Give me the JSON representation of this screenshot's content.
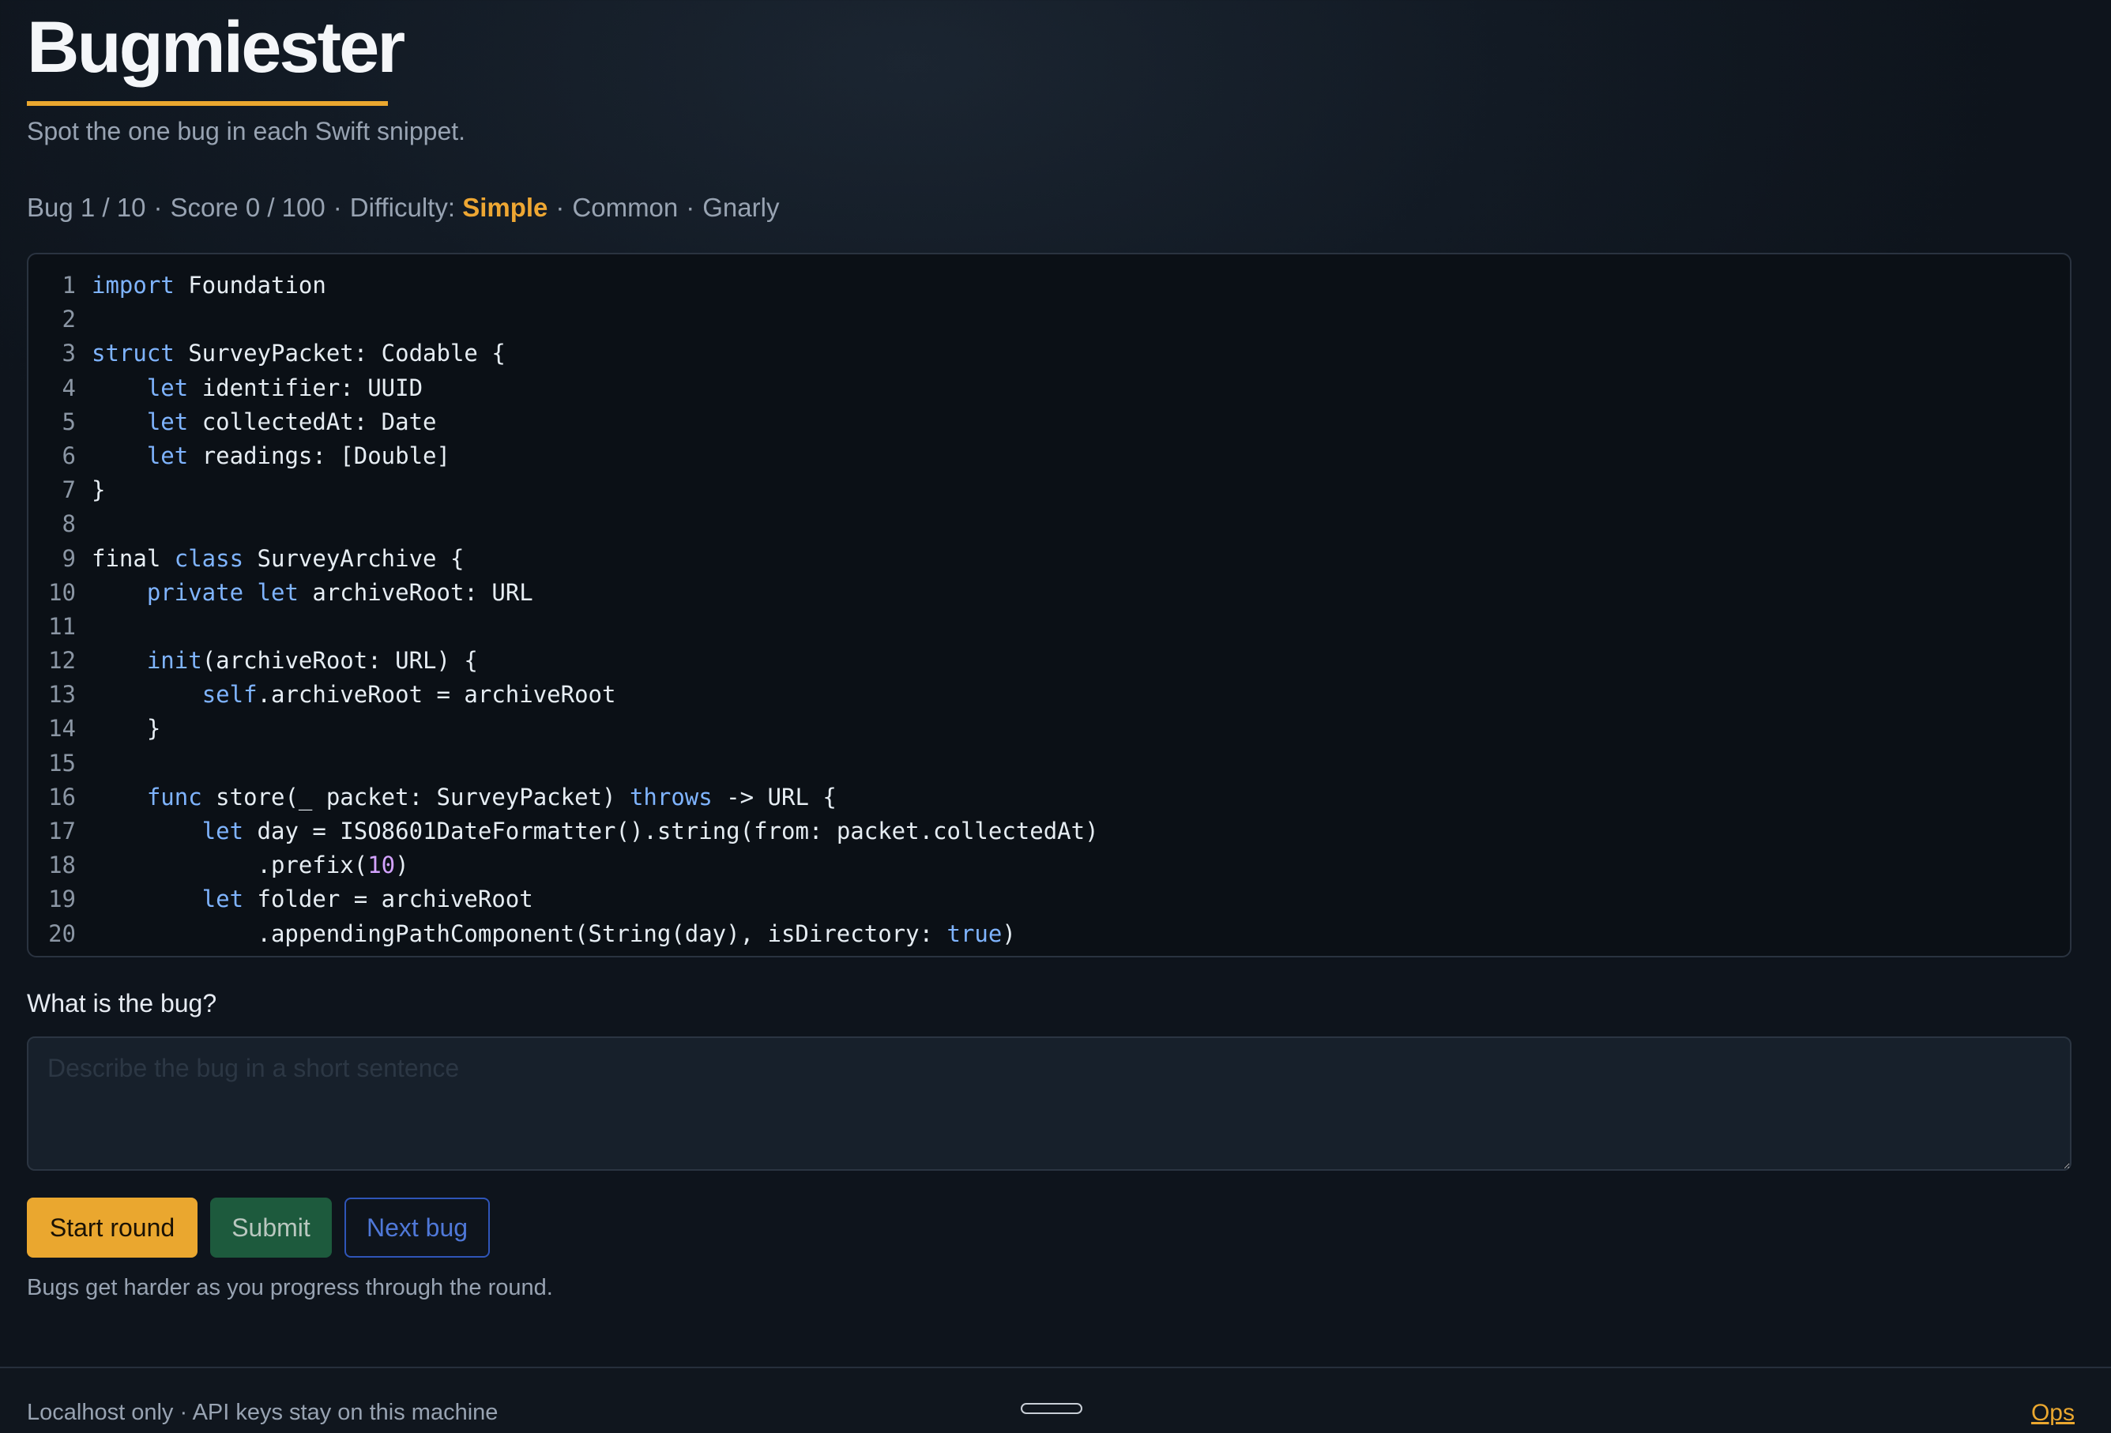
{
  "app": {
    "title": "Bugmiester",
    "subtitle": "Spot the one bug in each Swift snippet."
  },
  "status": {
    "bug_progress": "Bug 1 / 10",
    "score": "Score 0 / 100",
    "difficulty_label": "Difficulty:",
    "difficulties": [
      "Simple",
      "Common",
      "Gnarly"
    ],
    "active_difficulty": "Simple",
    "separator": "·"
  },
  "code": {
    "language": "Swift",
    "lines": [
      "import Foundation",
      "",
      "struct SurveyPacket: Codable {",
      "    let identifier: UUID",
      "    let collectedAt: Date",
      "    let readings: [Double]",
      "}",
      "",
      "final class SurveyArchive {",
      "    private let archiveRoot: URL",
      "",
      "    init(archiveRoot: URL) {",
      "        self.archiveRoot = archiveRoot",
      "    }",
      "",
      "    func store(_ packet: SurveyPacket) throws -> URL {",
      "        let day = ISO8601DateFormatter().string(from: packet.collectedAt)",
      "            .prefix(10)",
      "        let folder = archiveRoot",
      "            .appendingPathComponent(String(day), isDirectory: true)"
    ]
  },
  "answer": {
    "question": "What is the bug?",
    "placeholder": "Describe the bug in a short sentence",
    "value": ""
  },
  "buttons": {
    "start": "Start round",
    "submit": "Submit",
    "next": "Next bug"
  },
  "hint": "Bugs get harder as you progress through the round.",
  "footer": {
    "note": "Localhost only · API keys stay on this machine",
    "link": "Ops"
  },
  "colors": {
    "accent": "#eaa72f",
    "submit": "#1d5a3d",
    "next_border": "#2f55b8",
    "keyword": "#7fb4ff",
    "number": "#d4a3ff"
  }
}
